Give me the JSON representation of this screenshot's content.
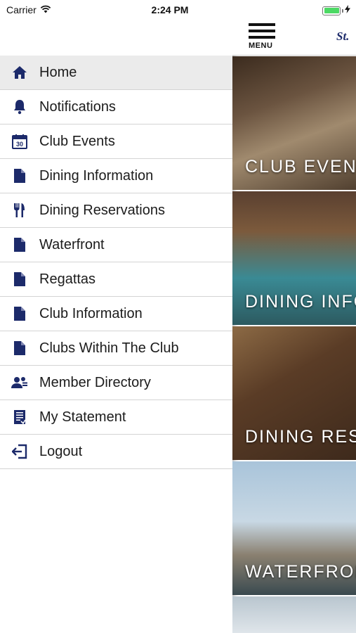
{
  "status_bar": {
    "carrier": "Carrier",
    "time": "2:24 PM",
    "battery_level": 1.0,
    "battery_color": "#4cd964"
  },
  "menu": {
    "active_index": 0,
    "icon_color": "#1c2a6a",
    "items": [
      {
        "label": "Home",
        "icon": "home-icon"
      },
      {
        "label": "Notifications",
        "icon": "bell-icon"
      },
      {
        "label": "Club Events",
        "icon": "calendar-icon",
        "icon_text": "30"
      },
      {
        "label": "Dining Information",
        "icon": "document-icon"
      },
      {
        "label": "Dining Reservations",
        "icon": "fork-knife-icon"
      },
      {
        "label": "Waterfront",
        "icon": "document-icon"
      },
      {
        "label": "Regattas",
        "icon": "document-icon"
      },
      {
        "label": "Club Information",
        "icon": "document-icon"
      },
      {
        "label": "Clubs Within The Club",
        "icon": "document-icon"
      },
      {
        "label": "Member Directory",
        "icon": "people-icon"
      },
      {
        "label": "My Statement",
        "icon": "statement-icon"
      },
      {
        "label": "Logout",
        "icon": "logout-icon"
      }
    ]
  },
  "content": {
    "menu_button_label": "MENU",
    "brand_text": "St.",
    "tiles": [
      {
        "caption": "CLUB EVENTS"
      },
      {
        "caption": "DINING INFORMATION"
      },
      {
        "caption": "DINING RESERVATIONS"
      },
      {
        "caption": "WATERFRONT"
      },
      {
        "caption": ""
      }
    ]
  }
}
